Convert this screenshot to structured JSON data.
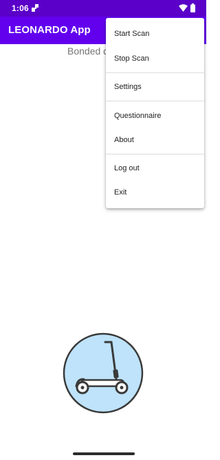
{
  "status_bar": {
    "time": "1:06",
    "background": "#5a00c8",
    "icons": [
      "notification-icon",
      "wifi-icon",
      "battery-icon"
    ]
  },
  "app_bar": {
    "title": "LEONARDO App",
    "background": "#6200ee"
  },
  "main": {
    "bonded_label": "Bonded d"
  },
  "overflow_menu": {
    "items": [
      {
        "label": "Start Scan"
      },
      {
        "label": "Stop Scan"
      },
      {
        "label": "Settings"
      },
      {
        "label": "Questionnaire"
      },
      {
        "label": "About"
      },
      {
        "label": "Log out"
      },
      {
        "label": "Exit"
      }
    ]
  },
  "logo": {
    "icon": "scooter-icon",
    "circle_fill": "#bee3fa"
  }
}
